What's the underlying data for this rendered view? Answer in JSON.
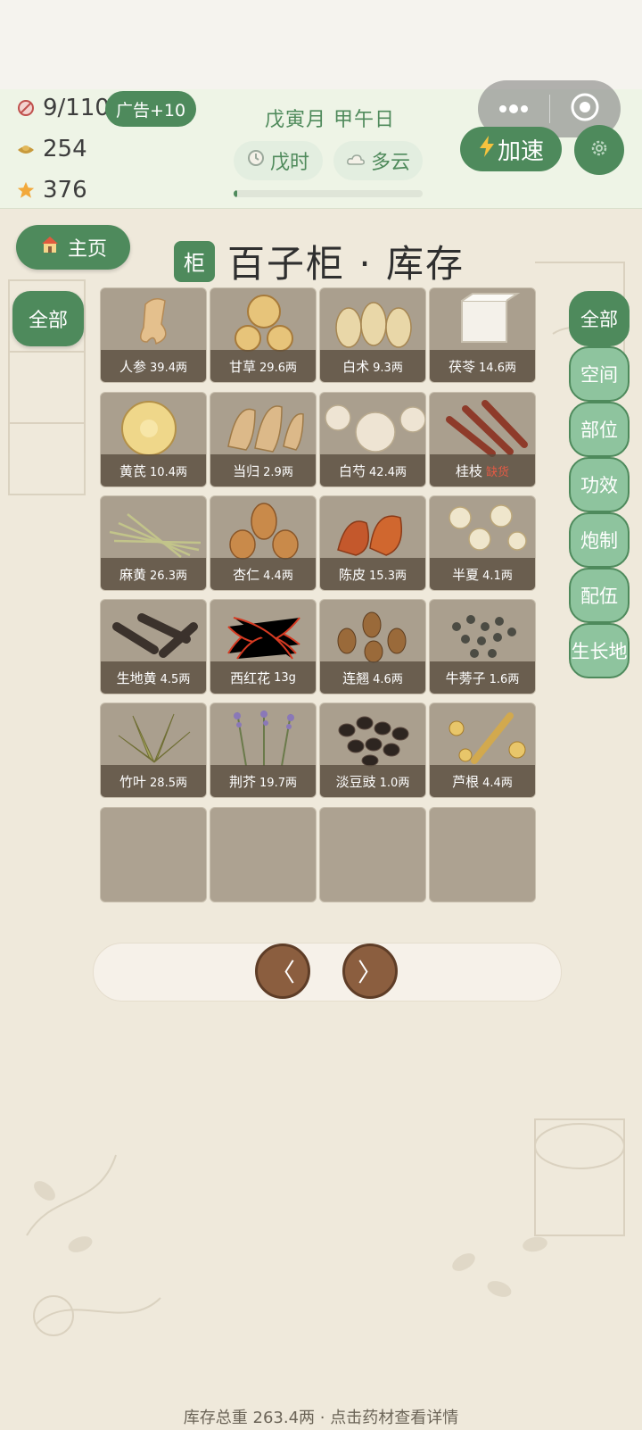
{
  "header": {
    "energy": "9/110",
    "ad_button": "广告+10",
    "coins": "254",
    "stars": "376",
    "date": "戊寅月 甲午日",
    "time_chip": "戊时",
    "weather_chip": "多云",
    "day_progress": 0.02,
    "speed_button": "加速"
  },
  "nav": {
    "home_button": "主页",
    "title_badge": "柜",
    "title": "百子柜 · 库存",
    "left_filter": "全部"
  },
  "side_tabs": [
    {
      "label": "全部",
      "active": true
    },
    {
      "label": "空间",
      "active": false
    },
    {
      "label": "部位",
      "active": false
    },
    {
      "label": "功效",
      "active": false
    },
    {
      "label": "炮制",
      "active": false
    },
    {
      "label": "配伍",
      "active": false
    },
    {
      "label": "生长地",
      "active": false
    }
  ],
  "items": [
    {
      "name": "人参",
      "amount": "39.4两",
      "icon": "ginseng-root"
    },
    {
      "name": "甘草",
      "amount": "29.6两",
      "icon": "licorice-slices"
    },
    {
      "name": "白术",
      "amount": "9.3两",
      "icon": "atractylodes-slices"
    },
    {
      "name": "茯苓",
      "amount": "14.6两",
      "icon": "poria-cube"
    },
    {
      "name": "黄芪",
      "amount": "10.4两",
      "icon": "astragalus-slice"
    },
    {
      "name": "当归",
      "amount": "2.9两",
      "icon": "angelica-slices"
    },
    {
      "name": "白芍",
      "amount": "42.4两",
      "icon": "peony-slices"
    },
    {
      "name": "桂枝",
      "amount": "",
      "status": "缺货",
      "icon": "cinnamon-twigs"
    },
    {
      "name": "麻黄",
      "amount": "26.3两",
      "icon": "ephedra-stems"
    },
    {
      "name": "杏仁",
      "amount": "4.4两",
      "icon": "apricot-kernels"
    },
    {
      "name": "陈皮",
      "amount": "15.3两",
      "icon": "tangerine-peel"
    },
    {
      "name": "半夏",
      "amount": "4.1两",
      "icon": "pinellia-tubers"
    },
    {
      "name": "生地黄",
      "amount": "4.5两",
      "icon": "rehmannia-roots"
    },
    {
      "name": "西红花",
      "amount": "13g",
      "icon": "saffron-threads"
    },
    {
      "name": "连翘",
      "amount": "4.6两",
      "icon": "forsythia-fruits"
    },
    {
      "name": "牛蒡子",
      "amount": "1.6两",
      "icon": "burdock-seeds"
    },
    {
      "name": "竹叶",
      "amount": "28.5两",
      "icon": "bamboo-leaves"
    },
    {
      "name": "荆芥",
      "amount": "19.7两",
      "icon": "schizonepeta-herb"
    },
    {
      "name": "淡豆豉",
      "amount": "1.0两",
      "icon": "fermented-soybeans"
    },
    {
      "name": "芦根",
      "amount": "4.4两",
      "icon": "reed-rhizome"
    }
  ],
  "pager": {
    "prev": "〈",
    "next": "〉"
  },
  "footer": "库存总重 263.4两 · 点击药材查看详情",
  "colors": {
    "accent": "#4e8a5c",
    "accent_light": "#8ec49e",
    "page_button": "#8b5e3f",
    "out_of_stock": "#e25a45"
  }
}
